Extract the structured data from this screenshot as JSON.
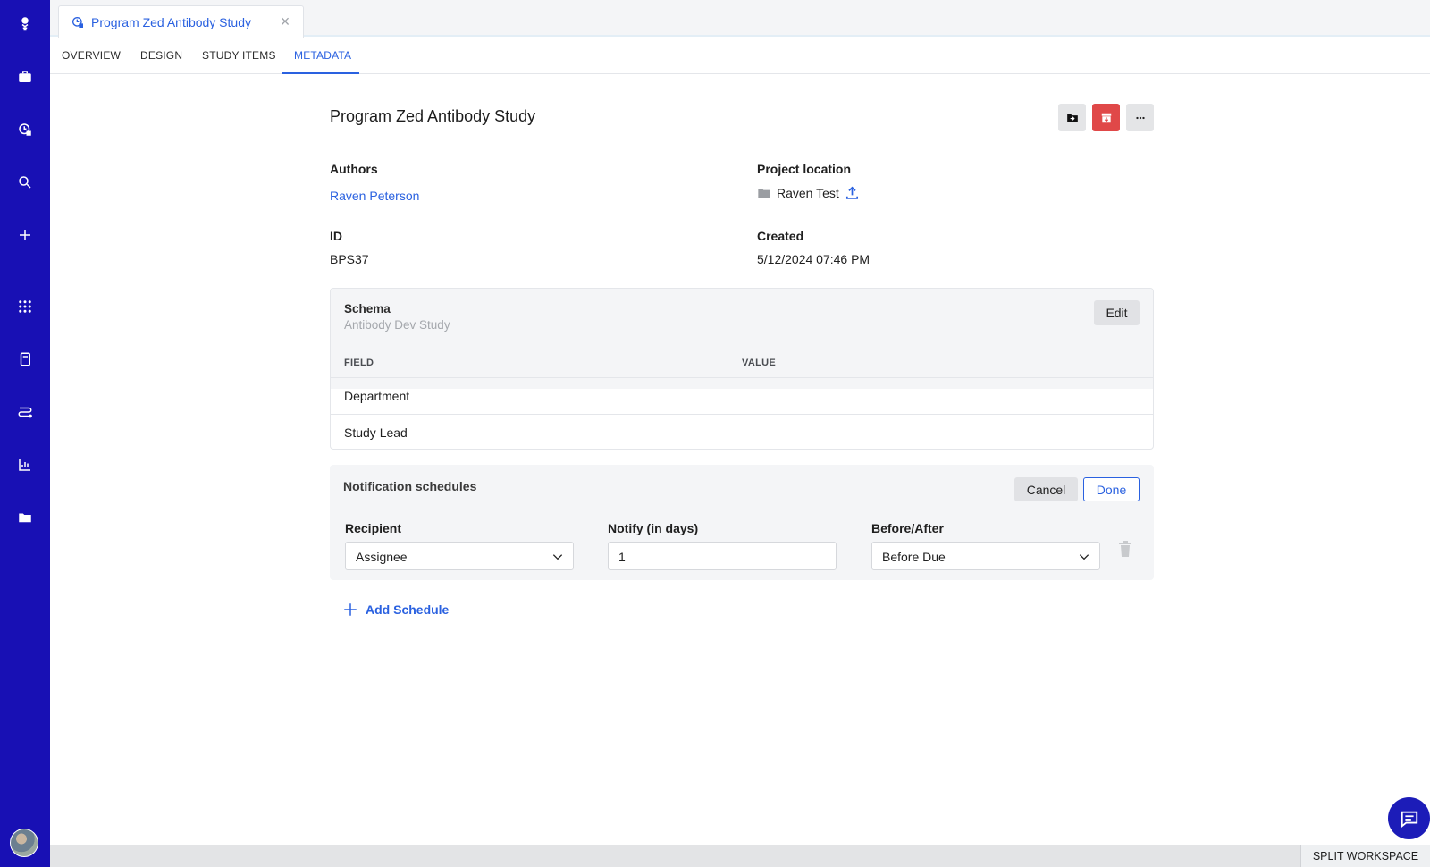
{
  "sidebar": {
    "icons": [
      "logo-icon",
      "briefcase-icon",
      "study-icon",
      "search-icon",
      "plus-icon",
      "apps-grid-icon",
      "notebook-icon",
      "workflow-icon",
      "chart-icon",
      "folder-sync-icon"
    ]
  },
  "tab": {
    "title": "Program Zed Antibody Study"
  },
  "nav": {
    "overview": "OVERVIEW",
    "design": "DESIGN",
    "study_items": "STUDY ITEMS",
    "metadata": "METADATA",
    "active": "METADATA"
  },
  "page": {
    "title": "Program Zed Antibody Study",
    "authors_label": "Authors",
    "authors_value": "Raven Peterson",
    "project_location_label": "Project location",
    "project_location_value": "Raven Test",
    "id_label": "ID",
    "id_value": "BPS37",
    "created_label": "Created",
    "created_value": "5/12/2024 07:46 PM"
  },
  "schema": {
    "title": "Schema",
    "subtitle": "Antibody Dev Study",
    "edit_label": "Edit",
    "columns": [
      "FIELD",
      "VALUE"
    ],
    "rows": [
      {
        "field": "Department",
        "value": ""
      },
      {
        "field": "Study Lead",
        "value": ""
      }
    ]
  },
  "notifications": {
    "title": "Notification schedules",
    "cancel_label": "Cancel",
    "done_label": "Done",
    "recipient_label": "Recipient",
    "recipient_value": "Assignee",
    "notify_label": "Notify (in days)",
    "notify_value": "1",
    "before_after_label": "Before/After",
    "before_after_value": "Before Due",
    "add_schedule_label": "Add Schedule"
  },
  "footer": {
    "split_workspace": "SPLIT WORKSPACE"
  },
  "colors": {
    "sidebar": "#1810b4",
    "accent": "#2a61e0",
    "danger": "#e04848"
  }
}
